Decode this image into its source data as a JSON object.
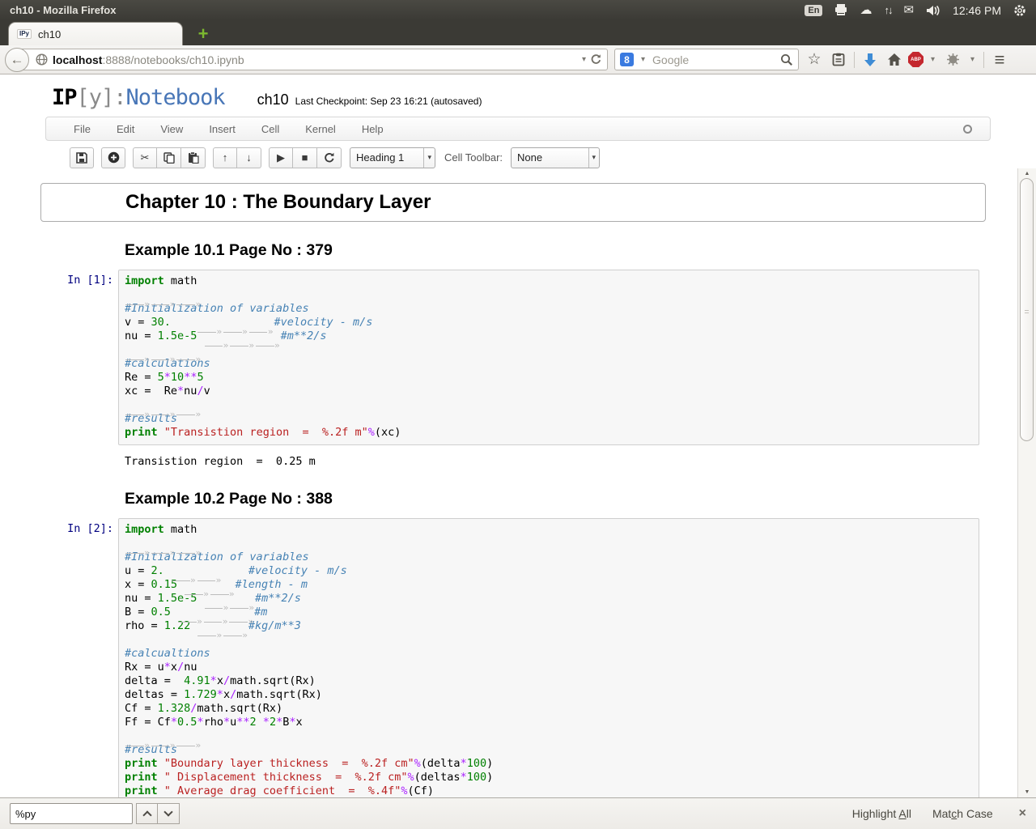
{
  "chrome": {
    "window_title": "ch10 - Mozilla Firefox",
    "keyboard_indicator": "En",
    "time": "12:46 PM"
  },
  "browser": {
    "tab_label": "ch10",
    "favicon_text": "IPy",
    "url_host": "localhost",
    "url_rest": ":8888/notebooks/ch10.ipynb",
    "search_placeholder": "Google",
    "search_logo": "8",
    "abp_label": "ABP"
  },
  "icons": {
    "back": "←",
    "caret": "▾",
    "star": "☆",
    "menu": "≡",
    "cloud": "☁",
    "mail": "✉",
    "net": "↑↓",
    "scissors": "✂",
    "arrow_up": "↑",
    "arrow_down": "↓",
    "play": "▶",
    "stop": "■",
    "scroll_up": "▲",
    "scroll_down": "▼",
    "newtab_plus": "+",
    "close": "×"
  },
  "notebook": {
    "logo_ip": "IP",
    "logo_y": "[y]:",
    "logo_name": "Notebook",
    "title": "ch10",
    "checkpoint": "Last Checkpoint: Sep 23 16:21 (autosaved)",
    "menus": [
      "File",
      "Edit",
      "View",
      "Insert",
      "Cell",
      "Kernel",
      "Help"
    ],
    "toolbar": {
      "cell_type": "Heading 1",
      "cell_toolbar_label": "Cell Toolbar:",
      "cell_toolbar_value": "None"
    },
    "syntax_colors": {
      "keyword": "#008000",
      "number": "#008000",
      "operator": "#AA22FF",
      "comment": "#4682B4",
      "string": "#BA2121",
      "prompt": "#000080"
    },
    "cells": [
      {
        "type": "heading1",
        "selected": true,
        "text": "Chapter 10 : The Boundary Layer"
      },
      {
        "type": "heading2",
        "text": "Example 10.1 Page No : 379"
      },
      {
        "type": "code",
        "prompt": "In [1]:",
        "lines": [
          [
            [
              "k",
              "import"
            ],
            [
              "x",
              " math"
            ]
          ],
          [
            [
              "t"
            ],
            [
              "t"
            ],
            [
              "t"
            ]
          ],
          [
            [
              "c",
              "#Initialization of variables"
            ]
          ],
          [
            [
              "x",
              "v = "
            ],
            [
              "n",
              "30."
            ],
            [
              "x",
              "    "
            ],
            [
              "t"
            ],
            [
              "t"
            ],
            [
              "t"
            ],
            [
              "c",
              "#velocity - m/s"
            ]
          ],
          [
            [
              "x",
              "nu = "
            ],
            [
              "n",
              "1.5e-5"
            ],
            [
              "x",
              " "
            ],
            [
              "t"
            ],
            [
              "t"
            ],
            [
              "t"
            ],
            [
              "c",
              "#m**2/s"
            ]
          ],
          [
            [
              "t"
            ],
            [
              "t"
            ],
            [
              "t"
            ]
          ],
          [
            [
              "c",
              "#calculations"
            ]
          ],
          [
            [
              "x",
              "Re = "
            ],
            [
              "n",
              "5"
            ],
            [
              "o",
              "*"
            ],
            [
              "n",
              "10"
            ],
            [
              "o",
              "**"
            ],
            [
              "n",
              "5"
            ]
          ],
          [
            [
              "x",
              "xc =  Re"
            ],
            [
              "o",
              "*"
            ],
            [
              "x",
              "nu"
            ],
            [
              "o",
              "/"
            ],
            [
              "x",
              "v"
            ]
          ],
          [
            [
              "t"
            ],
            [
              "t"
            ],
            [
              "t"
            ]
          ],
          [
            [
              "c",
              "#results"
            ]
          ],
          [
            [
              "k",
              "print"
            ],
            [
              "x",
              " "
            ],
            [
              "s",
              "\"Transistion region  =  %.2f m\""
            ],
            [
              "o",
              "%"
            ],
            [
              "x",
              "(xc)"
            ]
          ]
        ],
        "output": "Transistion region  =  0.25 m"
      },
      {
        "type": "heading2",
        "text": "Example 10.2 Page No : 388"
      },
      {
        "type": "code",
        "prompt": "In [2]:",
        "lines": [
          [
            [
              "k",
              "import"
            ],
            [
              "x",
              " math"
            ]
          ],
          [
            [
              "t"
            ],
            [
              "t"
            ],
            [
              "t"
            ]
          ],
          [
            [
              "c",
              "#Initialization of variables"
            ]
          ],
          [
            [
              "x",
              "u = "
            ],
            [
              "n",
              "2."
            ],
            [
              "x",
              " "
            ],
            [
              "t"
            ],
            [
              "t"
            ],
            [
              "x",
              "    "
            ],
            [
              "c",
              "#velocity - m/s"
            ]
          ],
          [
            [
              "x",
              "x = "
            ],
            [
              "n",
              "0.15"
            ],
            [
              "x",
              " "
            ],
            [
              "t"
            ],
            [
              "t"
            ],
            [
              "c",
              "#length - m"
            ]
          ],
          [
            [
              "x",
              "nu = "
            ],
            [
              "n",
              "1.5e-5"
            ],
            [
              "x",
              " "
            ],
            [
              "t"
            ],
            [
              "t"
            ],
            [
              "c",
              "#m**2/s"
            ]
          ],
          [
            [
              "x",
              "B = "
            ],
            [
              "n",
              "0.5"
            ],
            [
              "x",
              " "
            ],
            [
              "t"
            ],
            [
              "t"
            ],
            [
              "t"
            ],
            [
              "c",
              "#m"
            ]
          ],
          [
            [
              "x",
              "rho = "
            ],
            [
              "n",
              "1.22"
            ],
            [
              "x",
              " "
            ],
            [
              "t"
            ],
            [
              "t"
            ],
            [
              "c",
              "#kg/m**3"
            ]
          ],
          [],
          [
            [
              "c",
              "#calcualtions"
            ]
          ],
          [
            [
              "x",
              "Rx = u"
            ],
            [
              "o",
              "*"
            ],
            [
              "x",
              "x"
            ],
            [
              "o",
              "/"
            ],
            [
              "x",
              "nu"
            ]
          ],
          [
            [
              "x",
              "delta =  "
            ],
            [
              "n",
              "4.91"
            ],
            [
              "o",
              "*"
            ],
            [
              "x",
              "x"
            ],
            [
              "o",
              "/"
            ],
            [
              "x",
              "math.sqrt(Rx)"
            ]
          ],
          [
            [
              "x",
              "deltas = "
            ],
            [
              "n",
              "1.729"
            ],
            [
              "o",
              "*"
            ],
            [
              "x",
              "x"
            ],
            [
              "o",
              "/"
            ],
            [
              "x",
              "math.sqrt(Rx)"
            ]
          ],
          [
            [
              "x",
              "Cf = "
            ],
            [
              "n",
              "1.328"
            ],
            [
              "o",
              "/"
            ],
            [
              "x",
              "math.sqrt(Rx)"
            ]
          ],
          [
            [
              "x",
              "Ff = Cf"
            ],
            [
              "o",
              "*"
            ],
            [
              "n",
              "0.5"
            ],
            [
              "o",
              "*"
            ],
            [
              "x",
              "rho"
            ],
            [
              "o",
              "*"
            ],
            [
              "x",
              "u"
            ],
            [
              "o",
              "**"
            ],
            [
              "n",
              "2"
            ],
            [
              "x",
              " "
            ],
            [
              "o",
              "*"
            ],
            [
              "n",
              "2"
            ],
            [
              "o",
              "*"
            ],
            [
              "x",
              "B"
            ],
            [
              "o",
              "*"
            ],
            [
              "x",
              "x"
            ]
          ],
          [
            [
              "t"
            ],
            [
              "t"
            ],
            [
              "t"
            ]
          ],
          [
            [
              "c",
              "#results"
            ]
          ],
          [
            [
              "k",
              "print"
            ],
            [
              "x",
              " "
            ],
            [
              "s",
              "\"Boundary layer thickness  =  %.2f cm\""
            ],
            [
              "o",
              "%"
            ],
            [
              "x",
              "(delta"
            ],
            [
              "o",
              "*"
            ],
            [
              "n",
              "100"
            ],
            [
              "x",
              ")"
            ]
          ],
          [
            [
              "k",
              "print"
            ],
            [
              "x",
              " "
            ],
            [
              "s",
              "\" Displacement thickness  =  %.2f cm\""
            ],
            [
              "o",
              "%"
            ],
            [
              "x",
              "(deltas"
            ],
            [
              "o",
              "*"
            ],
            [
              "n",
              "100"
            ],
            [
              "x",
              ")"
            ]
          ],
          [
            [
              "k",
              "print"
            ],
            [
              "x",
              " "
            ],
            [
              "s",
              "\" Average drag coefficient  =  %.4f\""
            ],
            [
              "o",
              "%"
            ],
            [
              "x",
              "(Cf)"
            ]
          ]
        ]
      }
    ]
  },
  "findbar": {
    "query": "%py",
    "highlight": [
      "Highlight ",
      "A",
      "ll"
    ],
    "match": [
      "Mat",
      "c",
      "h Case"
    ]
  }
}
